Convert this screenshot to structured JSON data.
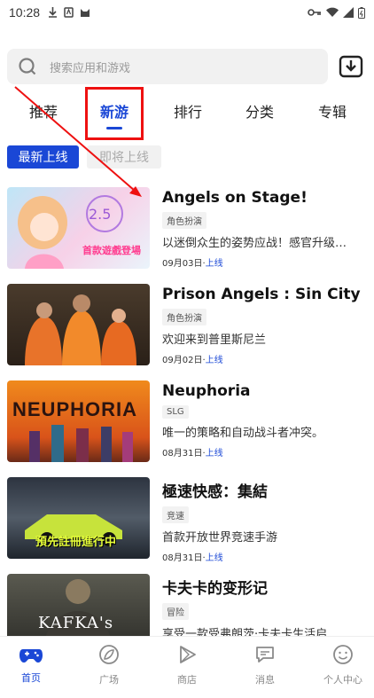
{
  "status": {
    "time": "10:28"
  },
  "search": {
    "placeholder": "搜索应用和游戏"
  },
  "tabs": [
    {
      "label": "推荐"
    },
    {
      "label": "新游"
    },
    {
      "label": "排行"
    },
    {
      "label": "分类"
    },
    {
      "label": "专辑"
    }
  ],
  "subtabs": [
    {
      "label": "最新上线"
    },
    {
      "label": "即将上线"
    }
  ],
  "games": [
    {
      "title": "Angels on Stage!",
      "tag": "角色扮演",
      "desc": "以迷倒众生的姿势应战！感官升级…",
      "date": "09月03日",
      "status": "上线",
      "thumb_text": "首款遊戲登場"
    },
    {
      "title": "Prison Angels : Sin City",
      "tag": "角色扮演",
      "desc": "欢迎来到普里斯尼兰",
      "date": "09月02日",
      "status": "上线",
      "thumb_text": ""
    },
    {
      "title": "Neuphoria",
      "tag": "SLG",
      "desc": "唯一的策略和自动战斗者冲突。",
      "date": "08月31日",
      "status": "上线",
      "thumb_text": "NEUPHORIA"
    },
    {
      "title": "極速快感：集結",
      "tag": "竞速",
      "desc": "首款开放世界竞速手游",
      "date": "08月31日",
      "status": "上线",
      "thumb_text": "預先註冊進行中"
    },
    {
      "title": "卡夫卡的变形记",
      "tag": "冒险",
      "desc": "享受一款受弗朗茨·卡夫卡生活启…",
      "date": "",
      "status": "",
      "thumb_text": "KAFKA's"
    }
  ],
  "nav": [
    {
      "label": "首页",
      "icon": "gamepad-icon"
    },
    {
      "label": "广场",
      "icon": "square-icon"
    },
    {
      "label": "商店",
      "icon": "store-icon"
    },
    {
      "label": "消息",
      "icon": "message-icon"
    },
    {
      "label": "个人中心",
      "icon": "profile-icon"
    }
  ],
  "colors": {
    "accent": "#1a47d6",
    "annotation": "#ee1111"
  }
}
